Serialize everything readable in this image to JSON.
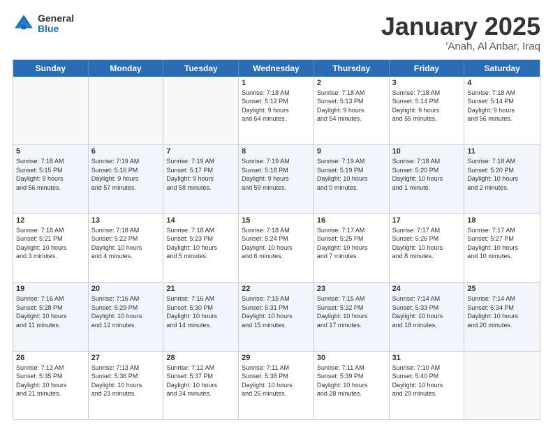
{
  "logo": {
    "general": "General",
    "blue": "Blue"
  },
  "title": {
    "month": "January 2025",
    "location": "'Anah, Al Anbar, Iraq"
  },
  "weekdays": [
    "Sunday",
    "Monday",
    "Tuesday",
    "Wednesday",
    "Thursday",
    "Friday",
    "Saturday"
  ],
  "rows": [
    [
      {
        "day": "",
        "info": ""
      },
      {
        "day": "",
        "info": ""
      },
      {
        "day": "",
        "info": ""
      },
      {
        "day": "1",
        "info": "Sunrise: 7:18 AM\nSunset: 5:12 PM\nDaylight: 9 hours\nand 54 minutes."
      },
      {
        "day": "2",
        "info": "Sunrise: 7:18 AM\nSunset: 5:13 PM\nDaylight: 9 hours\nand 54 minutes."
      },
      {
        "day": "3",
        "info": "Sunrise: 7:18 AM\nSunset: 5:14 PM\nDaylight: 9 hours\nand 55 minutes."
      },
      {
        "day": "4",
        "info": "Sunrise: 7:18 AM\nSunset: 5:14 PM\nDaylight: 9 hours\nand 56 minutes."
      }
    ],
    [
      {
        "day": "5",
        "info": "Sunrise: 7:18 AM\nSunset: 5:15 PM\nDaylight: 9 hours\nand 56 minutes."
      },
      {
        "day": "6",
        "info": "Sunrise: 7:19 AM\nSunset: 5:16 PM\nDaylight: 9 hours\nand 57 minutes."
      },
      {
        "day": "7",
        "info": "Sunrise: 7:19 AM\nSunset: 5:17 PM\nDaylight: 9 hours\nand 58 minutes."
      },
      {
        "day": "8",
        "info": "Sunrise: 7:19 AM\nSunset: 5:18 PM\nDaylight: 9 hours\nand 59 minutes."
      },
      {
        "day": "9",
        "info": "Sunrise: 7:19 AM\nSunset: 5:19 PM\nDaylight: 10 hours\nand 0 minutes."
      },
      {
        "day": "10",
        "info": "Sunrise: 7:18 AM\nSunset: 5:20 PM\nDaylight: 10 hours\nand 1 minute."
      },
      {
        "day": "11",
        "info": "Sunrise: 7:18 AM\nSunset: 5:20 PM\nDaylight: 10 hours\nand 2 minutes."
      }
    ],
    [
      {
        "day": "12",
        "info": "Sunrise: 7:18 AM\nSunset: 5:21 PM\nDaylight: 10 hours\nand 3 minutes."
      },
      {
        "day": "13",
        "info": "Sunrise: 7:18 AM\nSunset: 5:22 PM\nDaylight: 10 hours\nand 4 minutes."
      },
      {
        "day": "14",
        "info": "Sunrise: 7:18 AM\nSunset: 5:23 PM\nDaylight: 10 hours\nand 5 minutes."
      },
      {
        "day": "15",
        "info": "Sunrise: 7:18 AM\nSunset: 5:24 PM\nDaylight: 10 hours\nand 6 minutes."
      },
      {
        "day": "16",
        "info": "Sunrise: 7:17 AM\nSunset: 5:25 PM\nDaylight: 10 hours\nand 7 minutes."
      },
      {
        "day": "17",
        "info": "Sunrise: 7:17 AM\nSunset: 5:26 PM\nDaylight: 10 hours\nand 8 minutes."
      },
      {
        "day": "18",
        "info": "Sunrise: 7:17 AM\nSunset: 5:27 PM\nDaylight: 10 hours\nand 10 minutes."
      }
    ],
    [
      {
        "day": "19",
        "info": "Sunrise: 7:16 AM\nSunset: 5:28 PM\nDaylight: 10 hours\nand 11 minutes."
      },
      {
        "day": "20",
        "info": "Sunrise: 7:16 AM\nSunset: 5:29 PM\nDaylight: 10 hours\nand 12 minutes."
      },
      {
        "day": "21",
        "info": "Sunrise: 7:16 AM\nSunset: 5:30 PM\nDaylight: 10 hours\nand 14 minutes."
      },
      {
        "day": "22",
        "info": "Sunrise: 7:15 AM\nSunset: 5:31 PM\nDaylight: 10 hours\nand 15 minutes."
      },
      {
        "day": "23",
        "info": "Sunrise: 7:15 AM\nSunset: 5:32 PM\nDaylight: 10 hours\nand 17 minutes."
      },
      {
        "day": "24",
        "info": "Sunrise: 7:14 AM\nSunset: 5:33 PM\nDaylight: 10 hours\nand 18 minutes."
      },
      {
        "day": "25",
        "info": "Sunrise: 7:14 AM\nSunset: 5:34 PM\nDaylight: 10 hours\nand 20 minutes."
      }
    ],
    [
      {
        "day": "26",
        "info": "Sunrise: 7:13 AM\nSunset: 5:35 PM\nDaylight: 10 hours\nand 21 minutes."
      },
      {
        "day": "27",
        "info": "Sunrise: 7:13 AM\nSunset: 5:36 PM\nDaylight: 10 hours\nand 23 minutes."
      },
      {
        "day": "28",
        "info": "Sunrise: 7:12 AM\nSunset: 5:37 PM\nDaylight: 10 hours\nand 24 minutes."
      },
      {
        "day": "29",
        "info": "Sunrise: 7:11 AM\nSunset: 5:38 PM\nDaylight: 10 hours\nand 26 minutes."
      },
      {
        "day": "30",
        "info": "Sunrise: 7:11 AM\nSunset: 5:39 PM\nDaylight: 10 hours\nand 28 minutes."
      },
      {
        "day": "31",
        "info": "Sunrise: 7:10 AM\nSunset: 5:40 PM\nDaylight: 10 hours\nand 29 minutes."
      },
      {
        "day": "",
        "info": ""
      }
    ]
  ]
}
